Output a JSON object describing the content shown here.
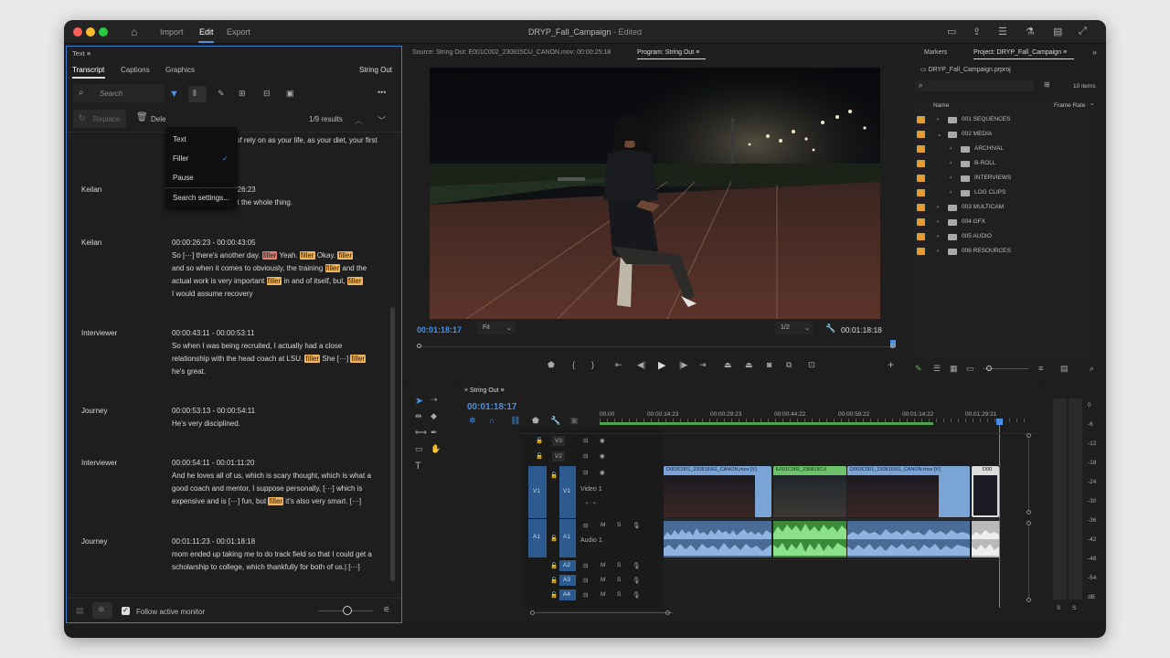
{
  "window": {
    "title": "DRYP_Fall_Campaign",
    "status": "- Edited",
    "menu": [
      "Import",
      "Edit",
      "Export"
    ]
  },
  "text_panel": {
    "title": "Text",
    "tabs": [
      "Transcript",
      "Captions",
      "Graphics"
    ],
    "seq_name": "String Out",
    "search_placeholder": "Search",
    "replace": "Replace",
    "delete": "Dele",
    "results": "1/9 results",
    "dropdown": {
      "items": [
        "Text",
        "Filler",
        "Pause",
        "Search settings..."
      ],
      "checked": "Filler"
    },
    "partial_line": "of rely on as your life, as your diet, your first",
    "follow": "Follow active monitor"
  },
  "transcript": [
    {
      "speaker": "Keilan",
      "time": "00:00:25:18 - 00:00:26:23",
      "lines": [
        [
          "be strong throughout the whole thing."
        ]
      ]
    },
    {
      "speaker": "Keilan",
      "time": "00:00:26:23 - 00:00:43:05",
      "lines": [
        [
          "So [···] there's another day. ",
          {
            "f": "filler",
            "a": 1
          },
          " Yeah. ",
          {
            "f": "filler"
          },
          " Okay. ",
          {
            "f": "filler"
          }
        ],
        [
          "and so when it comes to obviously, the training ",
          {
            "f": "filler"
          },
          " and the"
        ],
        [
          "actual work is very important ",
          {
            "f": "filler"
          },
          " in and of itself, but, ",
          {
            "f": "filler"
          }
        ],
        [
          "I would assume recovery"
        ]
      ]
    },
    {
      "speaker": "Interviewer",
      "time": "00:00:43:11 - 00:00:53:11",
      "lines": [
        [
          "So when I was being recruited, I actually had a close"
        ],
        [
          "relationship with the head coach at LSU. ",
          {
            "f": "filler"
          },
          " She [···] ",
          {
            "f": "filler"
          }
        ],
        [
          "he's great."
        ]
      ]
    },
    {
      "speaker": "Journey",
      "time": "00:00:53:13 - 00:00:54:11",
      "lines": [
        [
          "He's very disciplined."
        ]
      ]
    },
    {
      "speaker": "Interviewer",
      "time": "00:00:54:11 - 00:01:11:20",
      "lines": [
        [
          "And he loves all of us, which is scary thought, which is what a"
        ],
        [
          "good coach and mentor, I suppose personally, [···] which is"
        ],
        [
          "expensive and is [···] fun, but ",
          {
            "f": "filler"
          },
          " it's also very smart. [···]"
        ]
      ]
    },
    {
      "speaker": "Journey",
      "time": "00:01:11:23 - 00:01:18:18",
      "lines": [
        [
          "mom ended up taking me to do track field so that I could get a"
        ],
        [
          "scholarship to college, which thankfully for both of us.| [···]"
        ]
      ]
    }
  ],
  "source_monitor": {
    "label": "Source: String Out: E001C002_230815CU_CANON.mov: 00:00:25:18"
  },
  "program_monitor": {
    "label": "Program: String Out",
    "timecode": "00:01:18:17",
    "fit": "Fit",
    "res": "1/2",
    "duration": "00:01:18:18"
  },
  "project": {
    "tabs": [
      "Markers",
      "Project: DRYP_Fall_Campaign"
    ],
    "file": "DRYP_Fall_Campaign.prproj",
    "count": "10 items",
    "col_name": "Name",
    "col_rate": "Frame Rate",
    "bins": [
      "001 SEQUENCES",
      "002 MEDIA",
      "ARCHIVAL",
      "B-ROLL",
      "INTERVIEWS",
      "LOG CLIPS",
      "003 MULTICAM",
      "004 GFX",
      "005 AUDIO",
      "006 RESOURCES"
    ]
  },
  "timeline": {
    "title": "String Out",
    "timecode": "00:01:18:17",
    "ruler": [
      "00:00",
      "00:00:14:23",
      "00:00:29:23",
      "00:00:44:22",
      "00:00:59:22",
      "00:01:14:22",
      "00:01:29:21"
    ],
    "tracks": [
      "V3",
      "V2",
      "V1",
      "A1",
      "A2",
      "A3",
      "A4"
    ],
    "video_track_name": "Video 1",
    "audio_track_name": "Audio 1",
    "clips": [
      "D002C001_230816SG_CANON.mov [V]",
      "E001C002_230815CU",
      "D002C001_230816SG_CANON.mov [V]",
      "D00"
    ]
  },
  "meter": {
    "scale": [
      "0",
      "-6",
      "-12",
      "-18",
      "-24",
      "-30",
      "-36",
      "-42",
      "-48",
      "-54",
      "dB"
    ],
    "solo": [
      "S",
      "S"
    ]
  },
  "colors": {
    "filler": "#f0b55e",
    "filler_active": "#e77e6b",
    "accent": "#4a90e2",
    "clip_blue": "#7aa3d6",
    "clip_green": "#6cc36a",
    "bin": "#e59b35"
  }
}
